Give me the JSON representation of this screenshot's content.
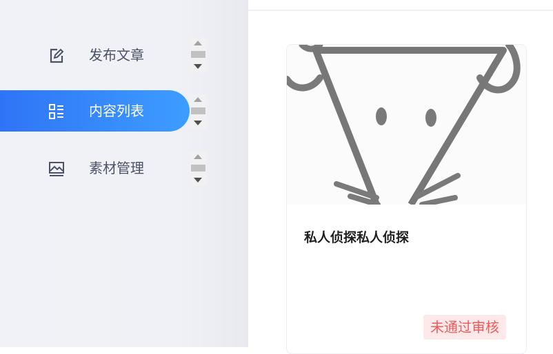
{
  "sidebar": {
    "items": [
      {
        "label": "发布文章",
        "icon": "edit-icon",
        "active": false
      },
      {
        "label": "内容列表",
        "icon": "list-icon",
        "active": true
      },
      {
        "label": "素材管理",
        "icon": "image-icon",
        "active": false
      }
    ]
  },
  "article_card": {
    "title": "私人侦探私人侦探",
    "status": "未通过审核",
    "cover_image": "sketch-mouse-face"
  },
  "colors": {
    "accent_start": "#2f74f6",
    "accent_end": "#3d9dff",
    "sidebar_bg": "#f1f2f7",
    "status_text": "#ef5b5b",
    "status_bg": "#fde9e9"
  }
}
